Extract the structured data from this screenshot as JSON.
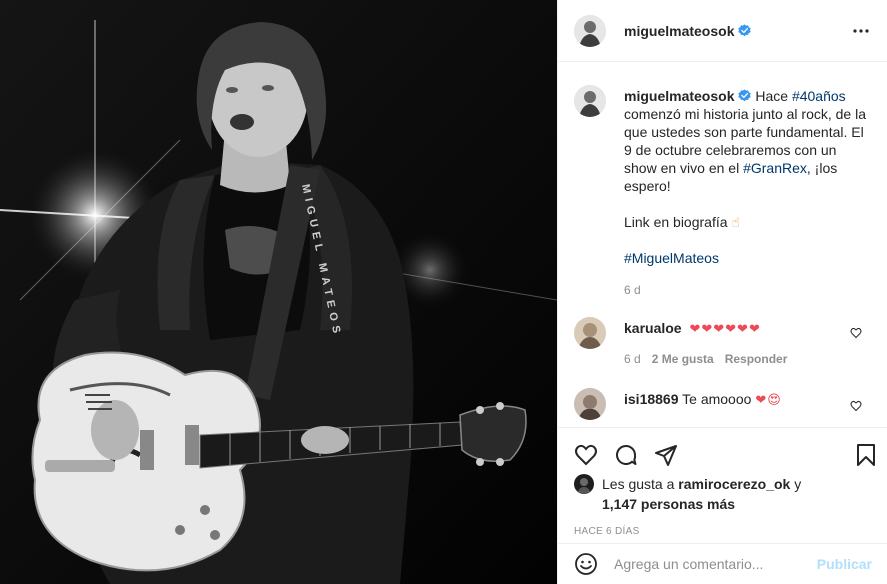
{
  "post": {
    "author": "miguelmateosok",
    "verified_icon": "verified-badge-icon",
    "more_icon": "more-options-icon",
    "photo_guitar_strap_text": "MIGUEL MATEOS"
  },
  "caption": {
    "username": "miguelmateosok",
    "text_before": "Hace ",
    "tag1": "#40años",
    "text_middle": " comenzó mi historia junto al rock, de la que ustedes son parte fundamental. El 9 de octubre celebraremos con un show en vivo en el ",
    "tag2": "#GranRex",
    "text_after": ", ¡los espero!",
    "line2": "Link en biografía",
    "line2_emoji": "☝",
    "tag3": "#MiguelMateos",
    "age": "6 d"
  },
  "comments": [
    {
      "username": "karualoe",
      "text": "❤❤❤❤❤❤",
      "age": "6 d",
      "likes": "2 Me gusta",
      "reply": "Responder"
    },
    {
      "username": "isi18869",
      "text": "Te amoooo",
      "emoji": "❤😍"
    }
  ],
  "actions": {
    "like_icon": "heart-icon",
    "comment_icon": "comment-icon",
    "share_icon": "share-icon",
    "save_icon": "bookmark-icon"
  },
  "likes": {
    "prefix": "Les gusta a ",
    "user": "ramirocerezo_ok",
    "joiner": " y",
    "others": "1,147 personas más"
  },
  "timestamp": "HACE 6 DÍAS",
  "add_comment": {
    "placeholder": "Agrega un comentario...",
    "publish": "Publicar"
  },
  "colors": {
    "link": "#00376b",
    "verified": "#3897f0",
    "heart": "#ed4956",
    "publish_disabled": "#b2dffc"
  }
}
